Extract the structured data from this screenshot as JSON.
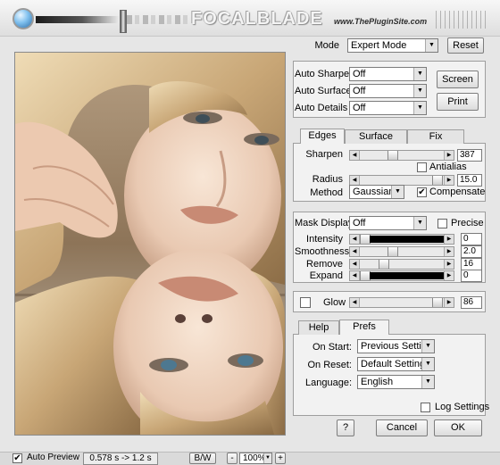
{
  "header": {
    "app_title": "FOCALBLADE",
    "site_url": "www.ThePluginSite.com"
  },
  "mode": {
    "label": "Mode",
    "value": "Expert Mode",
    "reset_label": "Reset"
  },
  "auto_panel": {
    "auto_sharpen": {
      "label": "Auto Sharpen",
      "value": "Off"
    },
    "auto_surface": {
      "label": "Auto Surface",
      "value": "Off"
    },
    "auto_details": {
      "label": "Auto Details",
      "value": "Off"
    },
    "screen_label": "Screen",
    "print_label": "Print"
  },
  "edges_tabs": {
    "tabs": [
      "Edges",
      "Surface",
      "Fix"
    ],
    "active": "Edges"
  },
  "edges": {
    "sharpen": {
      "label": "Sharpen",
      "value": "387"
    },
    "antialias_label": "Antialias",
    "antialias_checked": false,
    "radius": {
      "label": "Radius",
      "value": "15.0"
    },
    "method": {
      "label": "Method",
      "value": "Gaussian"
    },
    "compensate_label": "Compensate",
    "compensate_checked": true
  },
  "mask": {
    "display": {
      "label": "Mask Display",
      "value": "Off"
    },
    "precise_label": "Precise",
    "precise_checked": false,
    "intensity": {
      "label": "Intensity",
      "value": "0"
    },
    "smoothness": {
      "label": "Smoothness",
      "value": "2.0"
    },
    "remove": {
      "label": "Remove",
      "value": "16"
    },
    "expand": {
      "label": "Expand",
      "value": "0"
    }
  },
  "glow": {
    "label": "Glow",
    "value": "86",
    "checked": false
  },
  "prefs_tabs": {
    "tabs": [
      "Help",
      "Prefs"
    ],
    "active": "Prefs"
  },
  "prefs": {
    "on_start": {
      "label": "On Start:",
      "value": "Previous Settings"
    },
    "on_reset": {
      "label": "On Reset:",
      "value": "Default Settings"
    },
    "language": {
      "label": "Language:",
      "value": "English"
    },
    "log_settings_label": "Log Settings",
    "log_settings_checked": false
  },
  "dialog": {
    "help_label": "?",
    "cancel_label": "Cancel",
    "ok_label": "OK"
  },
  "bottom": {
    "auto_preview_label": "Auto Preview",
    "auto_preview_checked": true,
    "timing": "0.578 s -> 1.2 s",
    "bw_label": "B/W",
    "zoom_minus": "-",
    "zoom_value": "100%",
    "zoom_plus": "+"
  }
}
